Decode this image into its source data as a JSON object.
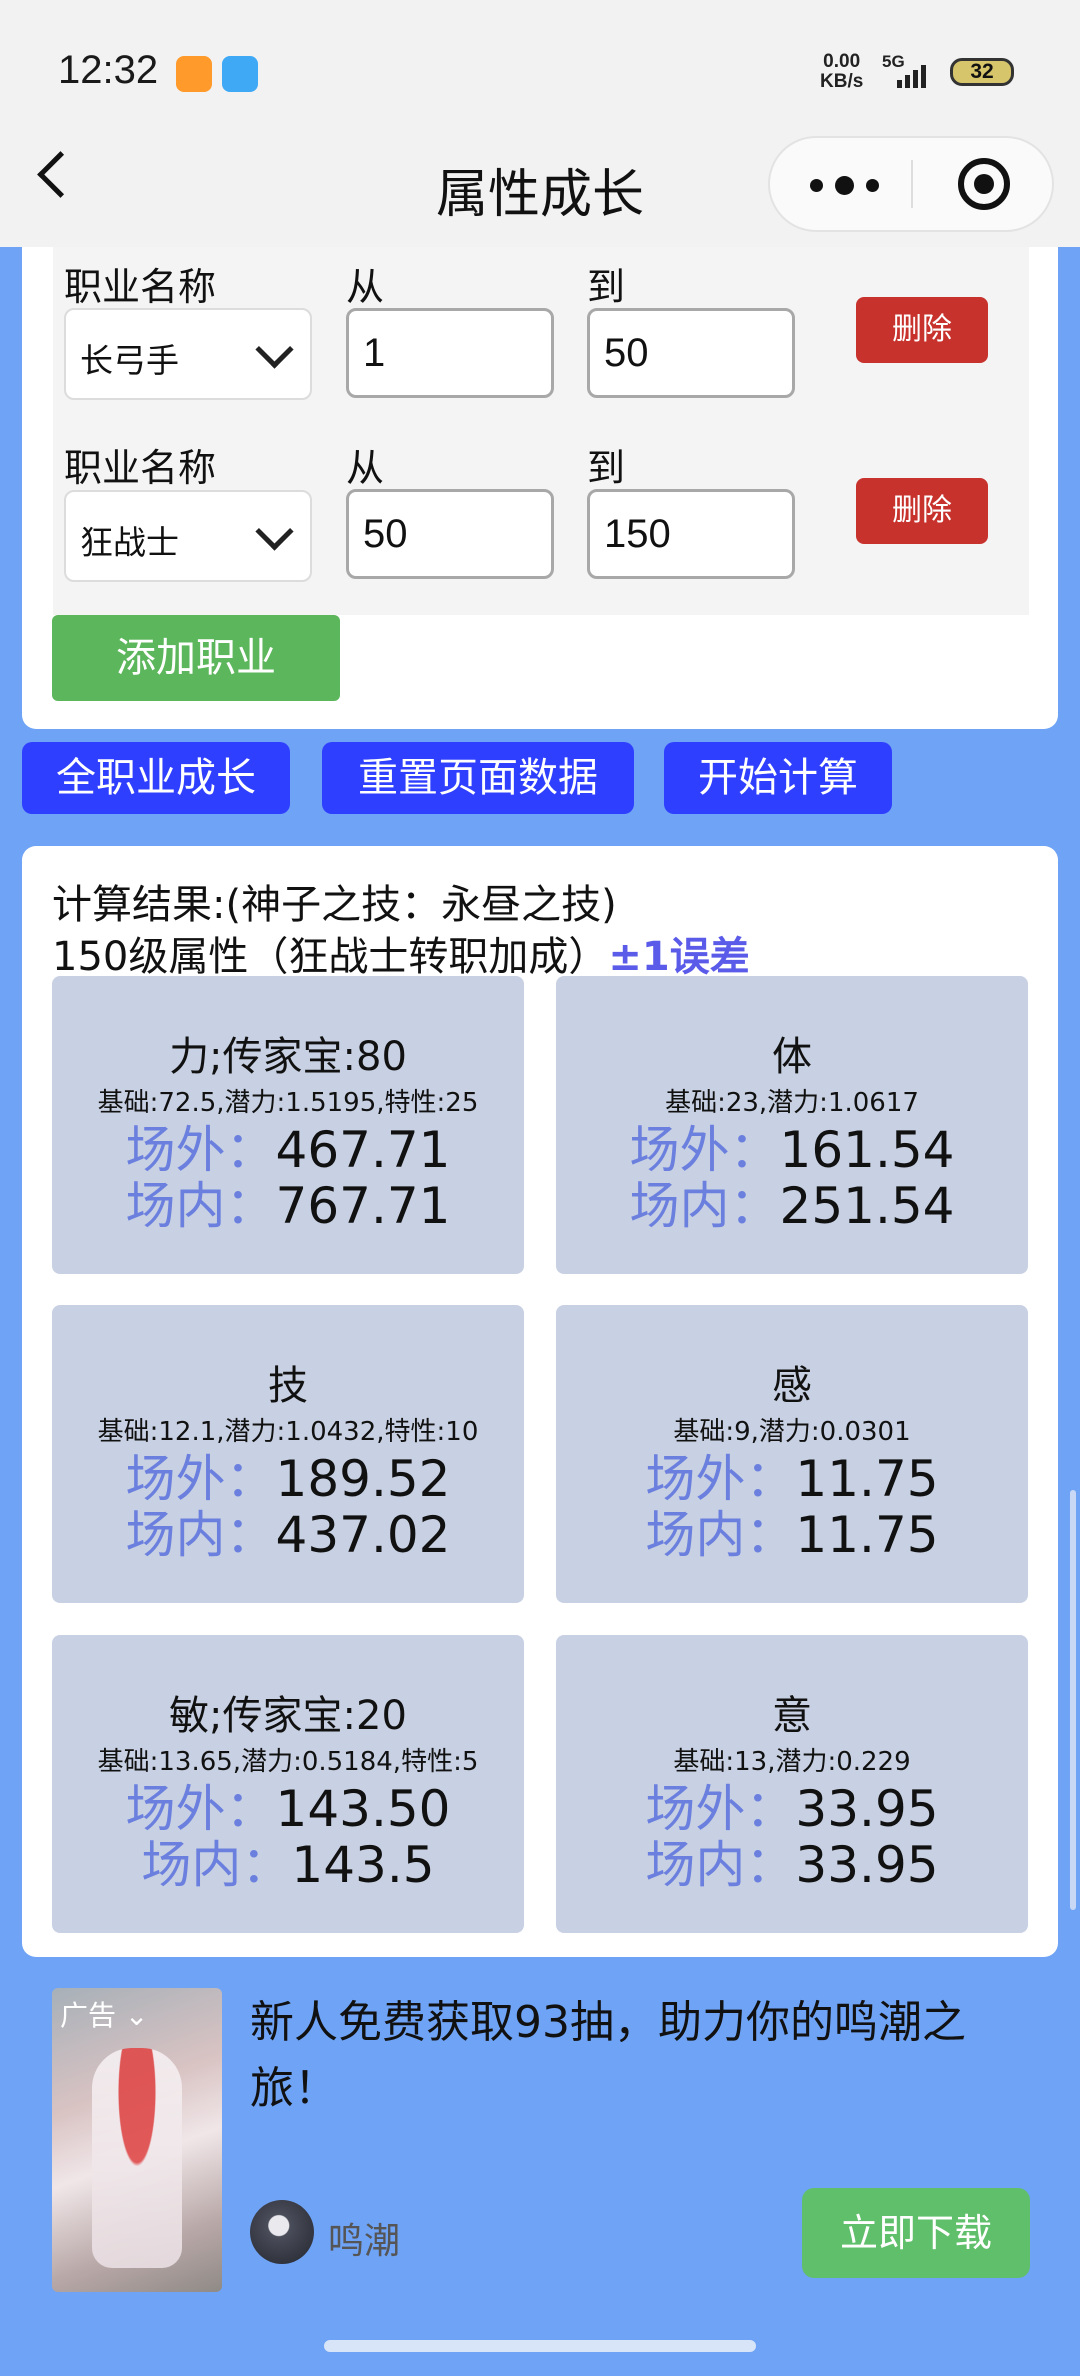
{
  "status_bar": {
    "time": "12:32",
    "net_speed": "0.00",
    "net_unit": "KB/s",
    "network": "5G",
    "battery": "32"
  },
  "nav": {
    "title": "属性成长"
  },
  "professions": [
    {
      "label_name": "职业名称",
      "name": "长弓手",
      "label_from": "从",
      "from": "1",
      "label_to": "到",
      "to": "50",
      "delete": "删除"
    },
    {
      "label_name": "职业名称",
      "name": "狂战士",
      "label_from": "从",
      "from": "50",
      "label_to": "到",
      "to": "150",
      "delete": "删除"
    }
  ],
  "add_profession": "添加职业",
  "actions": {
    "all_growth": "全职业成长",
    "reset": "重置页面数据",
    "calculate": "开始计算"
  },
  "result": {
    "line1": "计算结果:(神子之技：永昼之技)",
    "line2": "150级属性（狂战士转职加成）",
    "error_note": "±1误差",
    "outside_label": "场外：",
    "inside_label": "场内：",
    "stats": [
      {
        "title": "力;传家宝:80",
        "base": "基础:72.5,潜力:1.5195,特性:25",
        "outside": "467.71",
        "inside": "767.71"
      },
      {
        "title": "体",
        "base": "基础:23,潜力:1.0617",
        "outside": "161.54",
        "inside": "251.54"
      },
      {
        "title": "技",
        "base": "基础:12.1,潜力:1.0432,特性:10",
        "outside": "189.52",
        "inside": "437.02"
      },
      {
        "title": "感",
        "base": "基础:9,潜力:0.0301",
        "outside": "11.75",
        "inside": "11.75"
      },
      {
        "title": "敏;传家宝:20",
        "base": "基础:13.65,潜力:0.5184,特性:5",
        "outside": "143.50",
        "inside": "143.5"
      },
      {
        "title": "意",
        "base": "基础:13,潜力:0.229",
        "outside": "33.95",
        "inside": "33.95"
      }
    ]
  },
  "ad": {
    "tag": "广告",
    "title": "新人免费获取93抽，助力你的鸣潮之旅！",
    "advertiser": "鸣潮",
    "button": "立即下载"
  }
}
